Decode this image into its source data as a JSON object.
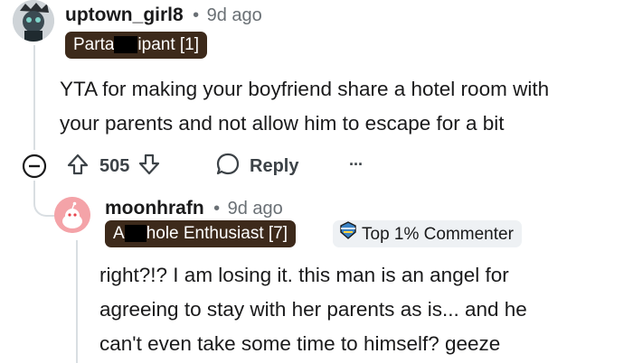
{
  "comment1": {
    "username": "uptown_girl8",
    "separator": "•",
    "age": "9d ago",
    "flair": {
      "before": "Parta",
      "after": "ipant [1]"
    },
    "body_line1": "YTA for making your boyfriend share a hotel room with",
    "body_line2": "your parents and not allow him to escape for a bit",
    "vote_count": "505",
    "reply_label": "Reply",
    "more_label": "···"
  },
  "comment2": {
    "username": "moonhrafn",
    "separator": "•",
    "age": "9d ago",
    "flair": {
      "before": "A",
      "after": "hole Enthusiast [7]"
    },
    "badge_label": "Top 1% Commenter",
    "body_line1": "right?!? I am losing it. this man is an angel for",
    "body_line2": "agreeing to stay with her parents as is... and he",
    "body_line3": "can't even take some time to himself? geeze"
  },
  "colors": {
    "flair_dark": "#3d2a1b",
    "badge_bg": "#eef1f4",
    "thread_line": "#d9dee2",
    "avatar2_bg": "#f4a3a8"
  },
  "icons": [
    "collapse-icon",
    "upvote-icon",
    "downvote-icon",
    "reply-bubble-icon",
    "more-options-icon",
    "top-commenter-badge-icon"
  ]
}
